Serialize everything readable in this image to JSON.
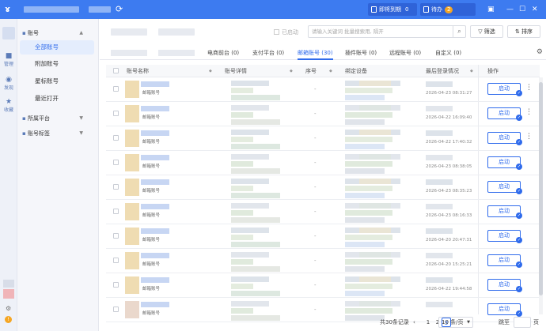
{
  "titlebar": {
    "expiring_label": "即将到期",
    "expiring_count": "0",
    "todo_label": "待办",
    "todo_count": "2",
    "icons": [
      "refresh-icon",
      "shirt-icon",
      "minimize-icon",
      "maximize-icon",
      "close-icon"
    ]
  },
  "leftbar": {
    "items": [
      {
        "icon": "■",
        "label": "管理"
      },
      {
        "icon": "◉",
        "label": "发现"
      },
      {
        "icon": "★",
        "label": "收藏"
      }
    ]
  },
  "sidebar": {
    "group_accounts": "账号",
    "items": [
      {
        "label": "全部账号",
        "active": true
      },
      {
        "label": "附加账号",
        "active": false
      },
      {
        "label": "星标账号",
        "active": false
      },
      {
        "label": "最近打开",
        "active": false
      }
    ],
    "group_platform": "所属平台",
    "group_tags": "账号标签"
  },
  "toolbar": {
    "auto_start_label": "已启动",
    "search_placeholder": "请输入关键词 批量搜索用, 隔开",
    "filter_label": "筛选",
    "sort_label": "排序"
  },
  "tabs": [
    {
      "label": "电商前台 (0)",
      "active": false
    },
    {
      "label": "支付平台 (0)",
      "active": false
    },
    {
      "label": "邮箱账号 (30)",
      "active": true
    },
    {
      "label": "插件账号 (0)",
      "active": false
    },
    {
      "label": "远程账号 (0)",
      "active": false
    },
    {
      "label": "自定义 (0)",
      "active": false
    }
  ],
  "table": {
    "headers": {
      "name": "账号名称",
      "detail": "账号详情",
      "seq": "序号",
      "device": "绑定设备",
      "last_login": "最后登录情况",
      "ops": "操作"
    },
    "rows": [
      {
        "type": "邮箱账号",
        "seq": "-",
        "date": "2026-04-23 08:31:27",
        "launch": "启动"
      },
      {
        "type": "邮箱账号",
        "seq": "-",
        "date": "2026-04-22 16:09:40",
        "launch": "启动"
      },
      {
        "type": "邮箱账号",
        "seq": "-",
        "date": "2026-04-22 17:40:32",
        "launch": "启动"
      },
      {
        "type": "邮箱账号",
        "seq": "-",
        "date": "2026-04-23 08:38:05",
        "launch": "启动"
      },
      {
        "type": "邮箱账号",
        "seq": "-",
        "date": "2026-04-23 08:35:23",
        "launch": "启动"
      },
      {
        "type": "邮箱账号",
        "seq": "-",
        "date": "2026-04-23 08:16:33",
        "launch": "启动"
      },
      {
        "type": "邮箱账号",
        "seq": "-",
        "date": "2026-04-20 20:47:31",
        "launch": "启动"
      },
      {
        "type": "邮箱账号",
        "seq": "-",
        "date": "2026-04-20 15:25:21",
        "launch": "启动"
      },
      {
        "type": "邮箱账号",
        "seq": "-",
        "date": "2026-04-22 19:44:58",
        "launch": "启动"
      },
      {
        "type": "邮箱账号",
        "seq": "-",
        "date": "",
        "launch": "启动"
      }
    ]
  },
  "pager": {
    "total": "共30条记录",
    "pages": [
      "1",
      "2",
      "3"
    ],
    "current": "3",
    "page_size": "10 条/页",
    "jump_label": "跳至",
    "page_unit": "页"
  }
}
